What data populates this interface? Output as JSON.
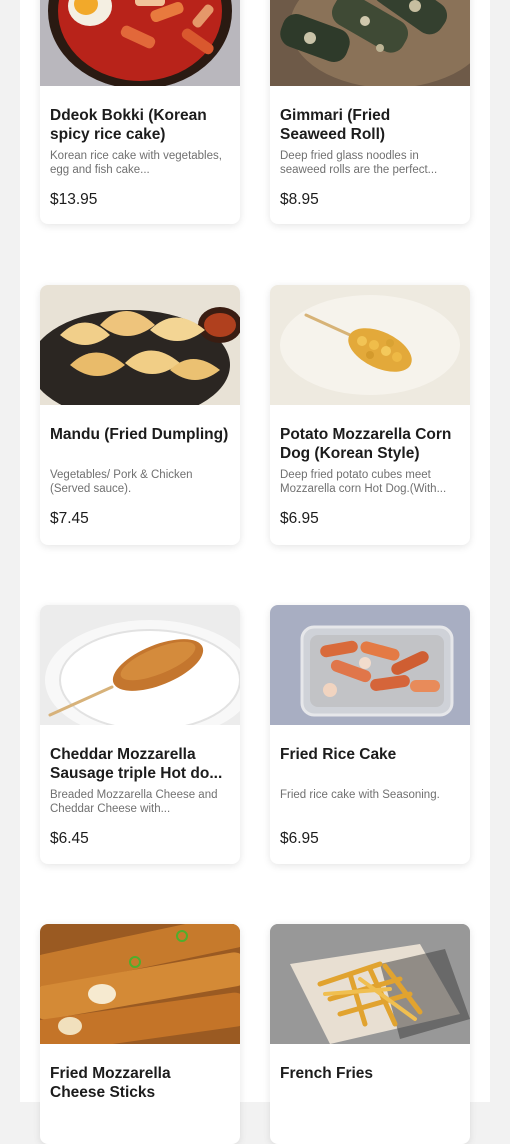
{
  "menu": {
    "items": [
      {
        "name": "Ddeok Bokki (Korean spicy rice cake)",
        "description": "Korean rice cake with vegetables, egg and fish cake...",
        "price": "$13.95",
        "image": "tteokbokki-photo"
      },
      {
        "name": "Gimmari (Fried Seaweed Roll)",
        "description": "Deep fried glass noodles in seaweed rolls are the perfect...",
        "price": "$8.95",
        "image": "gimmari-photo"
      },
      {
        "name": "Mandu (Fried Dumpling)",
        "description": "Vegetables/ Pork & Chicken (Served sauce).",
        "price": "$7.45",
        "image": "dumpling-photo"
      },
      {
        "name": "Potato Mozzarella Corn Dog (Korean Style)",
        "description": "Deep fried potato cubes meet Mozzarella corn Hot Dog.(With...",
        "price": "$6.95",
        "image": "potato-corn-dog-photo"
      },
      {
        "name": "Cheddar Mozzarella Sausage triple Hot do...",
        "description": "Breaded Mozzarella Cheese and Cheddar Cheese with...",
        "price": "$6.45",
        "image": "cheese-hot-dog-photo"
      },
      {
        "name": "Fried Rice Cake",
        "description": "Fried rice cake with Seasoning.",
        "price": "$6.95",
        "image": "fried-rice-cake-photo"
      },
      {
        "name": "Fried Mozzarella Cheese Sticks",
        "description": "",
        "price": "",
        "image": "cheese-sticks-photo"
      },
      {
        "name": "French Fries",
        "description": "",
        "price": "",
        "image": "french-fries-photo"
      }
    ]
  }
}
